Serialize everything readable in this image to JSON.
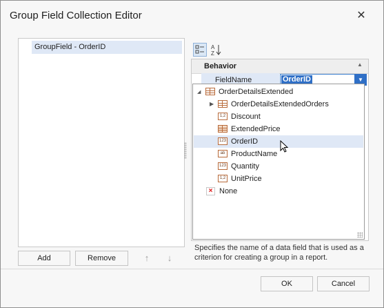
{
  "window": {
    "title": "Group Field Collection Editor",
    "close_glyph": "✕"
  },
  "fields_list": {
    "items": [
      "GroupField - OrderID"
    ]
  },
  "list_buttons": {
    "add": "Add",
    "remove": "Remove",
    "move_up": "↑",
    "move_down": "↓"
  },
  "property_grid": {
    "toolbar": {
      "categorized": "categorized-icon",
      "alphabetical": "sort-alphabetical-icon",
      "alpha_glyph": "A↓"
    },
    "category": {
      "label": "Behavior",
      "collapse_glyph": "▲"
    },
    "property": {
      "name": "FieldName",
      "value": "OrderID",
      "dropdown_glyph": "▼"
    },
    "description": "Specifies the name of a data field that is used as a criterion for creating a group in a report."
  },
  "field_picker": {
    "root": {
      "label": "OrderDetailsExtended",
      "expand_glyph": "◢"
    },
    "items": [
      {
        "label": "OrderDetailsExtendedOrders",
        "icon": "table-icon",
        "badge": "",
        "expand_glyph": "▶"
      },
      {
        "label": "Discount",
        "icon": "number-field-icon",
        "badge": "1,2"
      },
      {
        "label": "ExtendedPrice",
        "icon": "calculated-field-icon",
        "badge": ""
      },
      {
        "label": "OrderID",
        "icon": "integer-field-icon",
        "badge": "123"
      },
      {
        "label": "ProductName",
        "icon": "string-field-icon",
        "badge": "ab"
      },
      {
        "label": "Quantity",
        "icon": "integer-field-icon",
        "badge": "123"
      },
      {
        "label": "UnitPrice",
        "icon": "number-field-icon",
        "badge": "1,2"
      }
    ],
    "none": {
      "label": "None",
      "glyph": "×"
    }
  },
  "dialog_buttons": {
    "ok": "OK",
    "cancel": "Cancel"
  },
  "colors": {
    "accent": "#2f6fc6",
    "selection": "#dfe8f6",
    "field_icon": "#b86a3a"
  }
}
